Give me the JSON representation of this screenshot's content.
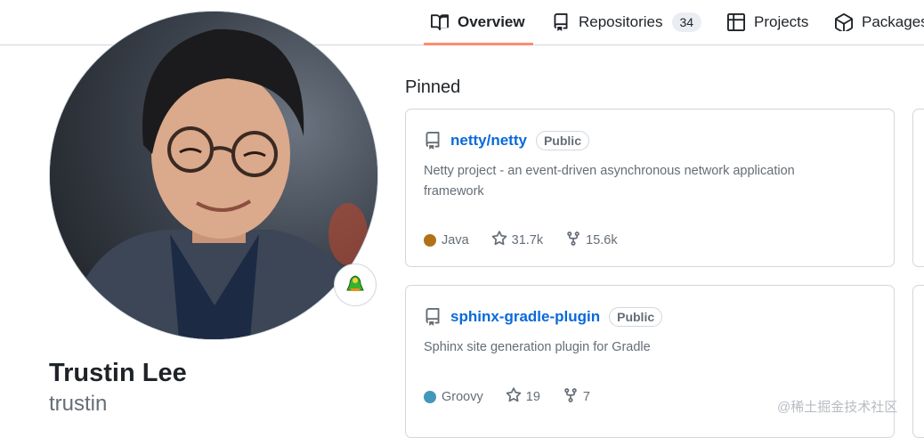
{
  "nav": {
    "tabs": [
      {
        "label": "Overview",
        "icon": "book-icon",
        "active": true
      },
      {
        "label": "Repositories",
        "icon": "repo-icon",
        "count": "34"
      },
      {
        "label": "Projects",
        "icon": "table-icon"
      },
      {
        "label": "Packages",
        "icon": "package-icon"
      }
    ]
  },
  "profile": {
    "name": "Trustin Lee",
    "username": "trustin",
    "status_icon": "bird-emoji-icon"
  },
  "pinned": {
    "title": "Pinned",
    "repos": [
      {
        "name": "netty/netty",
        "visibility": "Public",
        "description": "Netty project - an event-driven asynchronous network application framework",
        "language": "Java",
        "language_color": "#b07219",
        "stars": "31.7k",
        "forks": "15.6k"
      },
      {
        "name": "sphinx-gradle-plugin",
        "visibility": "Public",
        "description": "Sphinx site generation plugin for Gradle",
        "language": "Groovy",
        "language_color": "#4298b8",
        "stars": "19",
        "forks": "7"
      }
    ]
  },
  "watermark": "@稀土掘金技术社区",
  "colors": {
    "accent_underline": "#fd8c73",
    "link": "#0969da",
    "muted": "#656d76",
    "border": "#d0d7de"
  }
}
